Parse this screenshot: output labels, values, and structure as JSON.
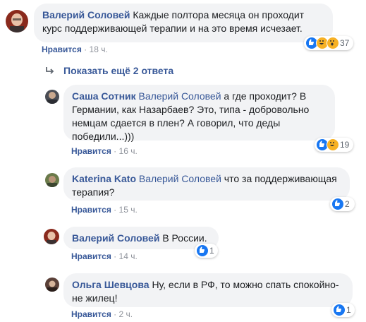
{
  "comments": [
    {
      "author": "Валерий Соловей",
      "text": "Каждые полтора месяца он проходит курс поддерживающей терапии и на это время исчезает.",
      "like_label": "Нравится",
      "time": "18 ч.",
      "reaction_count": "37"
    },
    {
      "author": "Саша Сотник",
      "mention": "Валерий Соловей",
      "text": "а где проходит? В Германии, как Назарбаев? Это, типа - добровольно немцам сдается в плен? А говорил, что деды победили...)))",
      "like_label": "Нравится",
      "time": "16 ч.",
      "reaction_count": "19"
    },
    {
      "author": "Katerina Kato",
      "mention": "Валерий Соловей",
      "text": "что за поддерживающая терапия?",
      "like_label": "Нравится",
      "time": "15 ч.",
      "reaction_count": "2"
    },
    {
      "author": "Валерий Соловей",
      "text": "В России.",
      "like_label": "Нравится",
      "time": "14 ч.",
      "reaction_count": "1"
    },
    {
      "author": "Ольга Шевцова",
      "text": "Ну, если в РФ, то можно спать спокойно- не жилец!",
      "like_label": "Нравится",
      "time": "2 ч.",
      "reaction_count": "1"
    }
  ],
  "more_replies_label": "Показать ещё 2 ответа",
  "colors": {
    "link": "#385898",
    "bubble": "#f2f3f5",
    "like_blue": "#1877f2",
    "wow_yellow": "#f7b125",
    "meta_gray": "#90949c"
  },
  "icons": {
    "reply_arrow": "reply-arrow-icon",
    "like": "like-reaction-icon",
    "haha": "haha-reaction-icon",
    "wow": "wow-reaction-icon"
  },
  "separator": "·"
}
